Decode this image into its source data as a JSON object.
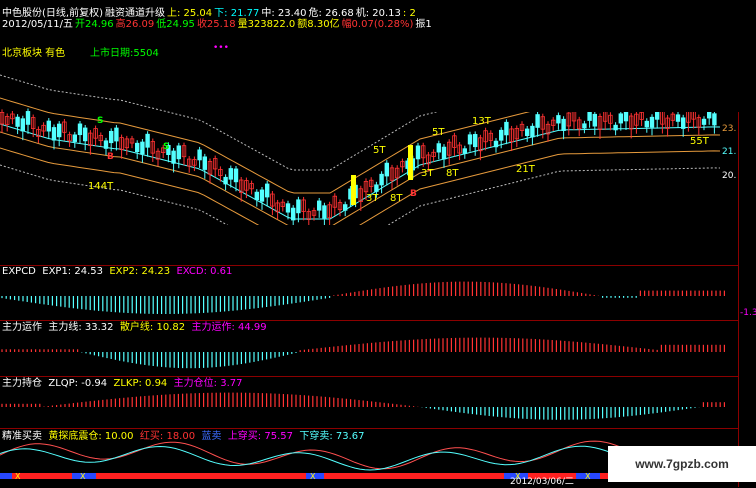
{
  "header": {
    "line1": [
      {
        "t": "中色股份(日线,前复权)",
        "c": "#ffffff"
      },
      {
        "t": "融资通道升级",
        "c": "#ffffff"
      },
      {
        "t": "上: 25.04",
        "c": "#ffff00"
      },
      {
        "t": "下: 21.77",
        "c": "#00ffff"
      },
      {
        "t": "中: 23.40",
        "c": "#ffffff"
      },
      {
        "t": "危: 26.68",
        "c": "#ffffff"
      },
      {
        "t": "机: 20.13",
        "c": "#ffffff"
      },
      {
        "t": ": 2",
        "c": "#ffff00"
      }
    ],
    "line2": [
      {
        "t": "2012/05/11/五",
        "c": "#ffffff"
      },
      {
        "t": "开24.96",
        "c": "#00ff00"
      },
      {
        "t": "高26.09",
        "c": "#ff3333"
      },
      {
        "t": "低24.95",
        "c": "#00ff00"
      },
      {
        "t": "收25.18",
        "c": "#ff3333"
      },
      {
        "t": "量323822.0",
        "c": "#ffff00"
      },
      {
        "t": "额8.30亿",
        "c": "#ffff00"
      },
      {
        "t": "幅0.07(0.28%)",
        "c": "#ff3333"
      },
      {
        "t": "振1",
        "c": "#ffffff"
      }
    ],
    "sector": "北京板块  有色",
    "listing": "上市日期:5504",
    "dots": "•••"
  },
  "price_labels": {
    "t144": "144T",
    "t5": "5T",
    "t3a": "3T",
    "t8a": "8T",
    "t3b": "3T",
    "t8b": "8T",
    "t5b": "5T",
    "t13": "13T",
    "t21": "21T",
    "t55": "55T"
  },
  "signals": {
    "S": "S",
    "B": "B"
  },
  "right_axis": {
    "p23": "23.",
    "p21": "21.",
    "p20": "20.",
    "neg": "-1.3"
  },
  "expcd": {
    "name": "EXPCD",
    "exp1": "EXP1: 24.53",
    "exp2": "EXP2: 24.23",
    "excd": "EXCD: 0.61"
  },
  "zlyz": {
    "name": "主力运作",
    "zll": "主力线: 33.32",
    "shl": "散户线: 10.82",
    "zlyz": "主力运作: 44.99"
  },
  "zlcc": {
    "name": "主力持仓",
    "zlqp": "ZLQP: -0.94",
    "zlkp": "ZLKP: 0.94",
    "zlcw": "主力仓位: 3.77"
  },
  "jzmm": {
    "name": "精准买卖",
    "htdzc": "黄探底震仓: 10.00",
    "hm": "红买: 18.00",
    "lm": "蓝卖",
    "smm": "上穿买: 75.57",
    "xcm": "下穿卖: 73.67"
  },
  "bottom": {
    "date": "2012/03/06/二",
    "x": "X"
  },
  "watermark": "www.7gpzb.com",
  "colors": {
    "up": "#ff3232",
    "down": "#54ffff",
    "yellow": "#ffff00",
    "magenta": "#ff00ff",
    "orange": "#e69a3c",
    "sep": "#8b0000"
  }
}
